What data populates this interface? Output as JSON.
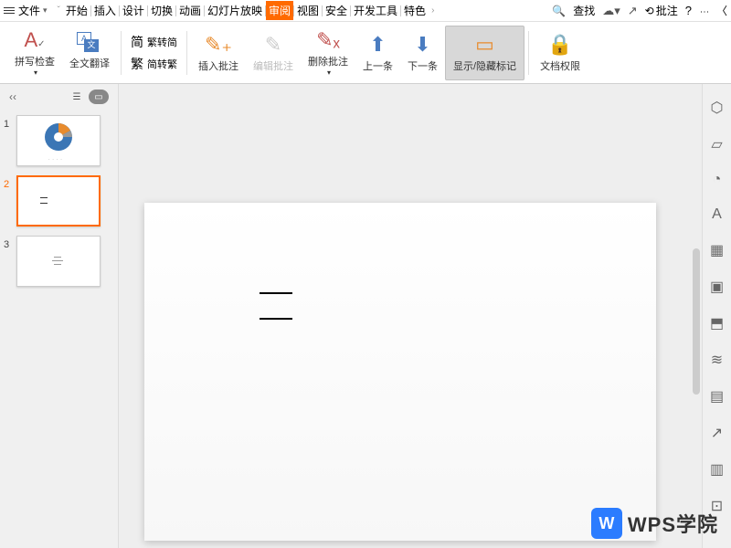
{
  "menubar": {
    "file": "文件",
    "tabs": [
      "开始",
      "插入",
      "设计",
      "切换",
      "动画",
      "幻灯片放映",
      "审阅",
      "视图",
      "安全",
      "开发工具",
      "特色"
    ],
    "active_tab": "审阅",
    "search": "查找",
    "annotate": "批注"
  },
  "toolbar": {
    "spellcheck": "拼写检查",
    "translate": "全文翻译",
    "to_simp": "繁转简",
    "to_trad": "简转繁",
    "insert_comment": "插入批注",
    "edit_comment": "编辑批注",
    "delete_comment": "删除批注",
    "prev": "上一条",
    "next": "下一条",
    "toggle_markup": "显示/隐藏标记",
    "doc_perm": "文档权限"
  },
  "panel": {
    "slides": [
      {
        "num": "1"
      },
      {
        "num": "2"
      },
      {
        "num": "3"
      }
    ],
    "selected": 2
  },
  "watermark": {
    "text": "WPS学院",
    "logo": "W"
  }
}
